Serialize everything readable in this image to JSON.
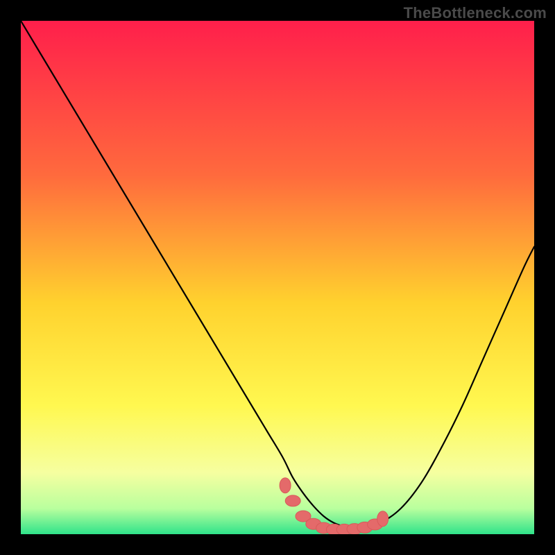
{
  "watermark": "TheBottleneck.com",
  "colors": {
    "background": "#000000",
    "grad_top": "#ff1f4b",
    "grad_mid1": "#ff6a3d",
    "grad_mid2": "#ffd22e",
    "grad_mid3": "#fff850",
    "grad_low1": "#f6ffa0",
    "grad_low2": "#b9ff9e",
    "grad_bottom": "#2fe38a",
    "curve": "#000000",
    "marker_fill": "#e46a6a",
    "marker_stroke": "#d85a5a"
  },
  "chart_data": {
    "type": "line",
    "title": "",
    "xlabel": "",
    "ylabel": "",
    "xlim": [
      0,
      100
    ],
    "ylim": [
      0,
      100
    ],
    "x": [
      0,
      3,
      6,
      9,
      12,
      15,
      18,
      21,
      24,
      27,
      30,
      33,
      36,
      39,
      42,
      45,
      48,
      51,
      53,
      55,
      57,
      59,
      61,
      63,
      65,
      67,
      70,
      74,
      78,
      82,
      86,
      90,
      94,
      98,
      100
    ],
    "values": [
      100,
      95,
      90,
      85,
      80,
      75,
      70,
      65,
      60,
      55,
      50,
      45,
      40,
      35,
      30,
      25,
      20,
      15,
      11,
      8,
      5.5,
      3.5,
      2.2,
      1.5,
      1.2,
      1.4,
      2.2,
      5,
      10,
      17,
      25,
      34,
      43,
      52,
      56
    ],
    "markers": {
      "x": [
        51.5,
        53,
        55,
        57,
        59,
        61,
        63,
        65,
        67,
        69,
        70.5
      ],
      "y": [
        9.5,
        6.5,
        3.5,
        2,
        1.2,
        0.9,
        0.9,
        1.0,
        1.3,
        1.9,
        3.0
      ]
    }
  }
}
